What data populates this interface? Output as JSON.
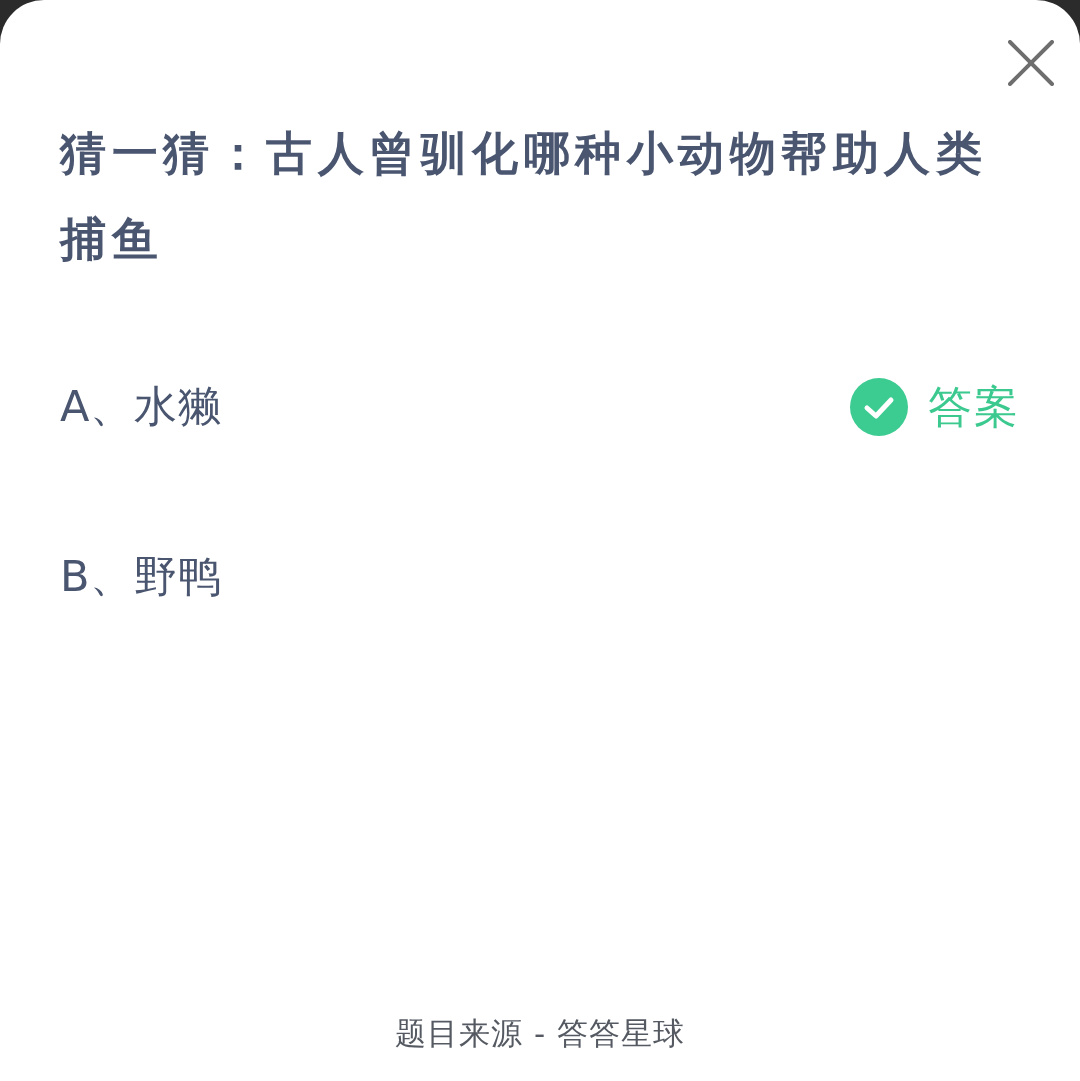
{
  "question": "猜一猜：古人曾驯化哪种小动物帮助人类捕鱼",
  "answer_badge": "答案",
  "options": [
    {
      "label": "A、水獭",
      "correct": true
    },
    {
      "label": "B、野鸭",
      "correct": false
    }
  ],
  "footer": "题目来源 - 答答星球"
}
